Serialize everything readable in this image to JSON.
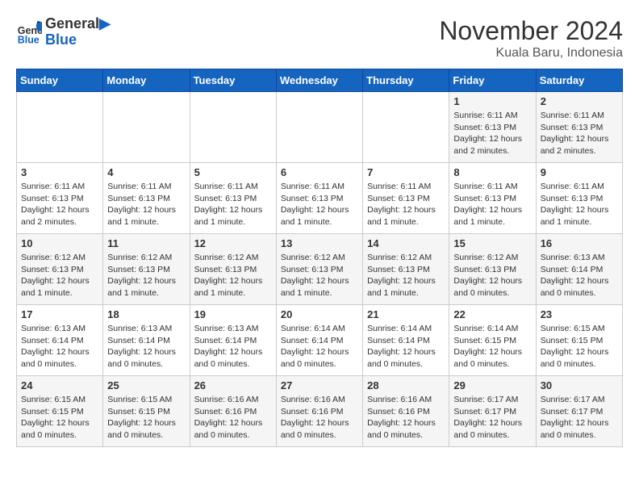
{
  "header": {
    "logo_line1": "General",
    "logo_line2": "Blue",
    "month_title": "November 2024",
    "location": "Kuala Baru, Indonesia"
  },
  "days_of_week": [
    "Sunday",
    "Monday",
    "Tuesday",
    "Wednesday",
    "Thursday",
    "Friday",
    "Saturday"
  ],
  "weeks": [
    {
      "days": [
        {
          "num": "",
          "info": ""
        },
        {
          "num": "",
          "info": ""
        },
        {
          "num": "",
          "info": ""
        },
        {
          "num": "",
          "info": ""
        },
        {
          "num": "",
          "info": ""
        },
        {
          "num": "1",
          "info": "Sunrise: 6:11 AM\nSunset: 6:13 PM\nDaylight: 12 hours\nand 2 minutes."
        },
        {
          "num": "2",
          "info": "Sunrise: 6:11 AM\nSunset: 6:13 PM\nDaylight: 12 hours\nand 2 minutes."
        }
      ]
    },
    {
      "days": [
        {
          "num": "3",
          "info": "Sunrise: 6:11 AM\nSunset: 6:13 PM\nDaylight: 12 hours\nand 2 minutes."
        },
        {
          "num": "4",
          "info": "Sunrise: 6:11 AM\nSunset: 6:13 PM\nDaylight: 12 hours\nand 1 minute."
        },
        {
          "num": "5",
          "info": "Sunrise: 6:11 AM\nSunset: 6:13 PM\nDaylight: 12 hours\nand 1 minute."
        },
        {
          "num": "6",
          "info": "Sunrise: 6:11 AM\nSunset: 6:13 PM\nDaylight: 12 hours\nand 1 minute."
        },
        {
          "num": "7",
          "info": "Sunrise: 6:11 AM\nSunset: 6:13 PM\nDaylight: 12 hours\nand 1 minute."
        },
        {
          "num": "8",
          "info": "Sunrise: 6:11 AM\nSunset: 6:13 PM\nDaylight: 12 hours\nand 1 minute."
        },
        {
          "num": "9",
          "info": "Sunrise: 6:11 AM\nSunset: 6:13 PM\nDaylight: 12 hours\nand 1 minute."
        }
      ]
    },
    {
      "days": [
        {
          "num": "10",
          "info": "Sunrise: 6:12 AM\nSunset: 6:13 PM\nDaylight: 12 hours\nand 1 minute."
        },
        {
          "num": "11",
          "info": "Sunrise: 6:12 AM\nSunset: 6:13 PM\nDaylight: 12 hours\nand 1 minute."
        },
        {
          "num": "12",
          "info": "Sunrise: 6:12 AM\nSunset: 6:13 PM\nDaylight: 12 hours\nand 1 minute."
        },
        {
          "num": "13",
          "info": "Sunrise: 6:12 AM\nSunset: 6:13 PM\nDaylight: 12 hours\nand 1 minute."
        },
        {
          "num": "14",
          "info": "Sunrise: 6:12 AM\nSunset: 6:13 PM\nDaylight: 12 hours\nand 1 minute."
        },
        {
          "num": "15",
          "info": "Sunrise: 6:12 AM\nSunset: 6:13 PM\nDaylight: 12 hours\nand 0 minutes."
        },
        {
          "num": "16",
          "info": "Sunrise: 6:13 AM\nSunset: 6:14 PM\nDaylight: 12 hours\nand 0 minutes."
        }
      ]
    },
    {
      "days": [
        {
          "num": "17",
          "info": "Sunrise: 6:13 AM\nSunset: 6:14 PM\nDaylight: 12 hours\nand 0 minutes."
        },
        {
          "num": "18",
          "info": "Sunrise: 6:13 AM\nSunset: 6:14 PM\nDaylight: 12 hours\nand 0 minutes."
        },
        {
          "num": "19",
          "info": "Sunrise: 6:13 AM\nSunset: 6:14 PM\nDaylight: 12 hours\nand 0 minutes."
        },
        {
          "num": "20",
          "info": "Sunrise: 6:14 AM\nSunset: 6:14 PM\nDaylight: 12 hours\nand 0 minutes."
        },
        {
          "num": "21",
          "info": "Sunrise: 6:14 AM\nSunset: 6:14 PM\nDaylight: 12 hours\nand 0 minutes."
        },
        {
          "num": "22",
          "info": "Sunrise: 6:14 AM\nSunset: 6:15 PM\nDaylight: 12 hours\nand 0 minutes."
        },
        {
          "num": "23",
          "info": "Sunrise: 6:15 AM\nSunset: 6:15 PM\nDaylight: 12 hours\nand 0 minutes."
        }
      ]
    },
    {
      "days": [
        {
          "num": "24",
          "info": "Sunrise: 6:15 AM\nSunset: 6:15 PM\nDaylight: 12 hours\nand 0 minutes."
        },
        {
          "num": "25",
          "info": "Sunrise: 6:15 AM\nSunset: 6:15 PM\nDaylight: 12 hours\nand 0 minutes."
        },
        {
          "num": "26",
          "info": "Sunrise: 6:16 AM\nSunset: 6:16 PM\nDaylight: 12 hours\nand 0 minutes."
        },
        {
          "num": "27",
          "info": "Sunrise: 6:16 AM\nSunset: 6:16 PM\nDaylight: 12 hours\nand 0 minutes."
        },
        {
          "num": "28",
          "info": "Sunrise: 6:16 AM\nSunset: 6:16 PM\nDaylight: 12 hours\nand 0 minutes."
        },
        {
          "num": "29",
          "info": "Sunrise: 6:17 AM\nSunset: 6:17 PM\nDaylight: 12 hours\nand 0 minutes."
        },
        {
          "num": "30",
          "info": "Sunrise: 6:17 AM\nSunset: 6:17 PM\nDaylight: 12 hours\nand 0 minutes."
        }
      ]
    }
  ]
}
